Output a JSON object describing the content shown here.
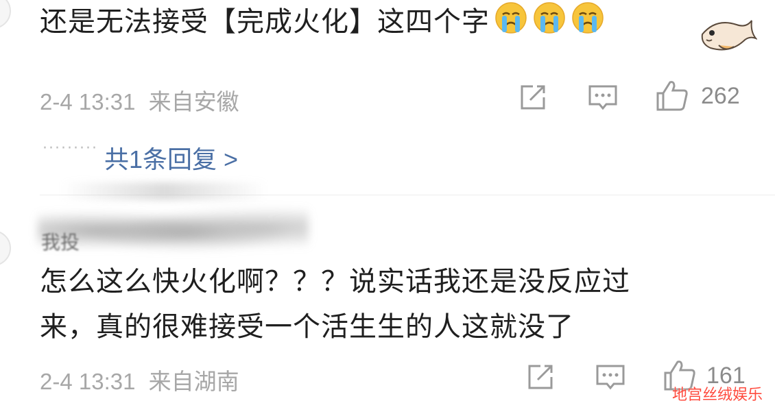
{
  "comments": [
    {
      "text_lines": [
        "还是无法接受【完成火化】这四个字"
      ],
      "emoji_count": 3,
      "emoji_icon": "crying-face-icon",
      "timestamp": "2-4 13:31",
      "location": "来自安徽",
      "likes": "262",
      "replies_label": "共1条回复 >"
    },
    {
      "author_handle_partial": "我投",
      "text_lines": [
        "怎么这么快火化啊？？？说实话我还是没反应过",
        "来，真的很难接受一个活生生的人这就没了"
      ],
      "timestamp": "2-4 13:31",
      "location": "来自湖南",
      "likes": "161"
    }
  ],
  "icons": {
    "share": "share-icon",
    "comment": "comment-icon",
    "like": "thumbs-up-icon",
    "sticker": "fish-sticker-icon"
  },
  "watermark": "地宫丝绒娱乐",
  "colors": {
    "reply_link": "#4a6fa5",
    "meta_text": "#a7a7a7",
    "watermark": "#ff4a3d"
  }
}
